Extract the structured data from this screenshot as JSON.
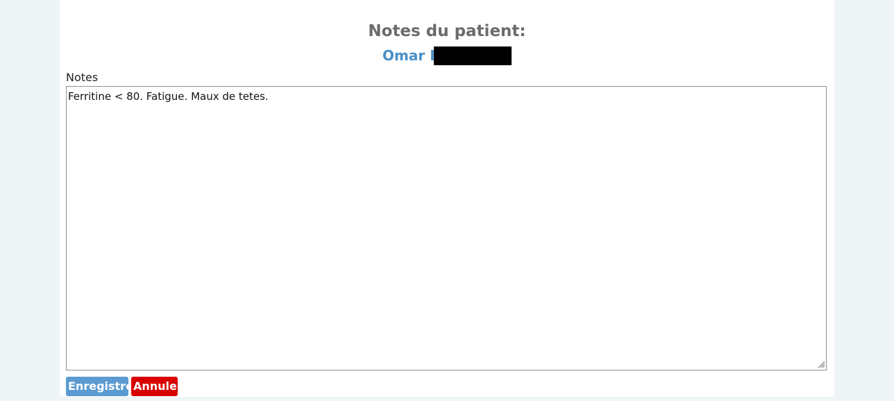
{
  "header": {
    "title": "Notes du patient:",
    "patient_name": "Omar L"
  },
  "form": {
    "notes_label": "Notes",
    "notes_value": "Ferritine < 80. Fatigue. Maux de tetes."
  },
  "actions": {
    "save_label": "Enregistrer",
    "cancel_label": "Annuler"
  },
  "colors": {
    "page_background": "#eff4f7",
    "title": "#6b6b6b",
    "patient_name": "#4a90c8",
    "save_button": "#5b9bd1",
    "cancel_button": "#d80000"
  },
  "icons": {
    "resize_grip": "resize-grip-icon"
  }
}
